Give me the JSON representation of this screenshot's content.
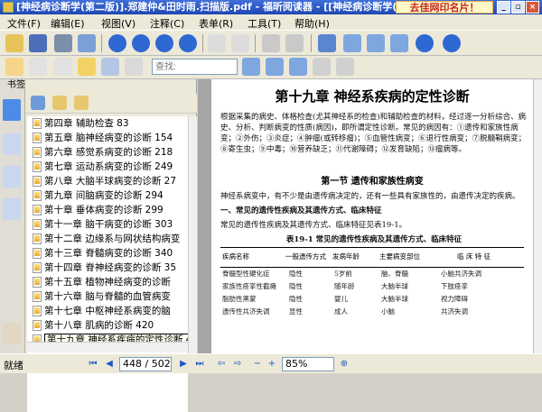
{
  "window": {
    "title": "[神经病诊断学(第二版)].郑建仲&田时雨.扫描版.pdf - 福昕阅读器 - [[神经病诊断学(第二版)].郑建仲&...",
    "promo": "去佳网印名片！",
    "minimize": "_",
    "restore": "▫",
    "close": "×"
  },
  "menu": [
    "文件(F)",
    "编辑(E)",
    "视图(V)",
    "注释(C)",
    "表单(R)",
    "工具(T)",
    "帮助(H)"
  ],
  "search": {
    "placeholder": "查找:"
  },
  "sidebar": {
    "header": "书签"
  },
  "bookmarks": [
    {
      "label": "第四章 辅助检查 83"
    },
    {
      "label": "第五章 脑神经病变的诊断 154"
    },
    {
      "label": "第六章 感觉系病变的诊断 218"
    },
    {
      "label": "第七章 运动系病变的诊断 249"
    },
    {
      "label": "第八章 大脑半球病变的诊断 27"
    },
    {
      "label": "第九章 间脑病变的诊断 294"
    },
    {
      "label": "第十章 垂体病变的诊断 299"
    },
    {
      "label": "第十一章 脑干病变的诊断 303"
    },
    {
      "label": "第十二章 边缘系与网状结构病变"
    },
    {
      "label": "第十三章 脊髓病变的诊断 340"
    },
    {
      "label": "第十四章 脊神经病变的诊断 35"
    },
    {
      "label": "第十五章 植物神经病变的诊断"
    },
    {
      "label": "第十六章 脑与脊髓的血管病变"
    },
    {
      "label": "第十七章 中枢神经系病变的脑"
    },
    {
      "label": "第十八章 肌病的诊断 420"
    },
    {
      "label": "第十九章 神经系疾病的定性诊断 438"
    }
  ],
  "document": {
    "chapter": "第十九章  神经系疾病的定性诊断",
    "para1": "根据采集的病史、体格检查(尤其神经系的检查)和辅助检查的材料，经过逐一分析综合、病史、分析、判断病变的性质(病因)，即所谓定性诊断。常见的病因有：①遗传和家族性病变；②外伤；③炎症；④肿瘤(或转移瘤)；⑤血管性病变；⑥退行性病变；⑦脱髓鞘病变；⑧寄生虫；⑨中毒；⑩营养缺乏；⑪代谢障碍；⑫发育缺陷；⑬瘤病等。",
    "section": "第一节    遗传和家族性病变",
    "para2": "神经系病变中，有不少是由遗传病决定的，还有一些具有家族性的，由遗传决定的疾病。",
    "para3": "一、常见的遗传性疾病及其遗传方式、临床特征",
    "para4": "常见的遗传性疾病及其遗传方式、临床特征见表19-1。",
    "table_caption": "表19-1  常见的遗传性疾病及其遗传方式、临床特征",
    "table_headers": [
      "疾病名称",
      "一般遗传方式",
      "发病年龄",
      "主要病变部位",
      "临 床 特 征"
    ],
    "table_rows": [
      [
        "脊髓型性硬化症",
        "隐性",
        "5岁前",
        "脑、脊髓",
        "小脑共济失调"
      ],
      [
        "家族性痉挛性截瘫",
        "隐性",
        "随年龄",
        "大脑半球",
        "下肢痉挛"
      ],
      [
        "",
        "",
        "",
        "",
        ""
      ],
      [
        "脂肪性黑蒙",
        "隐性",
        "婴儿",
        "大脑半球",
        "视力障碍"
      ],
      [
        "",
        "",
        "",
        "",
        ""
      ],
      [
        "遗传性共济失调",
        "显性",
        "成人",
        "小脑",
        "共济失调"
      ]
    ]
  },
  "status": {
    "ready": "就绪",
    "page": "448 / 502",
    "zoom": "85%"
  }
}
